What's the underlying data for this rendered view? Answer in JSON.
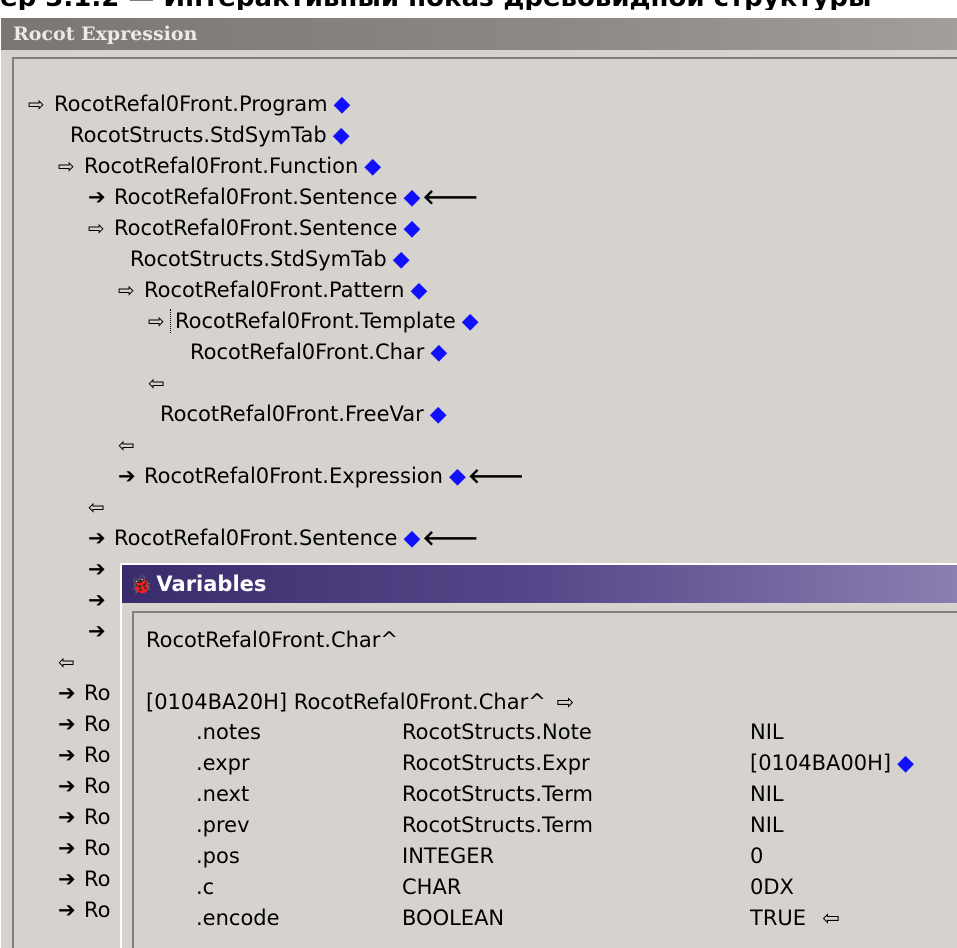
{
  "heading_text": "ер 3.1.2 — Интерактивный показ древовидной структуры",
  "window": {
    "title": "Rocot Expression"
  },
  "tree_rows": [
    {
      "label": "RocotRefal0Front.Program",
      "diamond": true
    },
    {
      "label": "RocotStructs.StdSymTab",
      "diamond": true
    },
    {
      "label": "RocotRefal0Front.Function",
      "diamond": true
    },
    {
      "label": "RocotRefal0Front.Sentence",
      "diamond": true
    },
    {
      "label": "RocotRefal0Front.Sentence",
      "diamond": true
    },
    {
      "label": "RocotStructs.StdSymTab",
      "diamond": true
    },
    {
      "label": "RocotRefal0Front.Pattern",
      "diamond": true
    },
    {
      "label": "RocotRefal0Front.Template",
      "diamond": true
    },
    {
      "label": "RocotRefal0Front.Char",
      "diamond": true
    },
    {
      "label": "RocotRefal0Front.FreeVar",
      "diamond": true
    },
    {
      "label": "RocotRefal0Front.Expression",
      "diamond": true
    },
    {
      "label": "RocotRefal0Front.Sentence",
      "diamond": true
    }
  ],
  "partial_label": "Ro",
  "variables_window": {
    "title": "Variables",
    "header": "RocotRefal0Front.Char^",
    "address_line": "[0104BA20H] RocotRefal0Front.Char^",
    "fields": [
      {
        "name": ".notes",
        "type": "RocotStructs.Note",
        "value": "NIL"
      },
      {
        "name": ".expr",
        "type": "RocotStructs.Expr",
        "value": "[0104BA00H]"
      },
      {
        "name": ".next",
        "type": "RocotStructs.Term",
        "value": "NIL"
      },
      {
        "name": ".prev",
        "type": "RocotStructs.Term",
        "value": "NIL"
      },
      {
        "name": ".pos",
        "type": "INTEGER",
        "value": "0"
      },
      {
        "name": ".c",
        "type": "CHAR",
        "value": "0DX"
      },
      {
        "name": ".encode",
        "type": "BOOLEAN",
        "value": "TRUE"
      }
    ]
  },
  "icons": {
    "expanded": "open-arrow-icon",
    "collapsed": "bold-right-arrow-icon",
    "collapse_back": "back-arrow-icon",
    "pointer_target": "blue-diamond-icon",
    "back_link": "bold-left-arrow-icon"
  },
  "colors": {
    "window_bg": "#d6d3ce",
    "diamond": "#1010ff",
    "variables_title_bg": "#3a2c6c"
  }
}
